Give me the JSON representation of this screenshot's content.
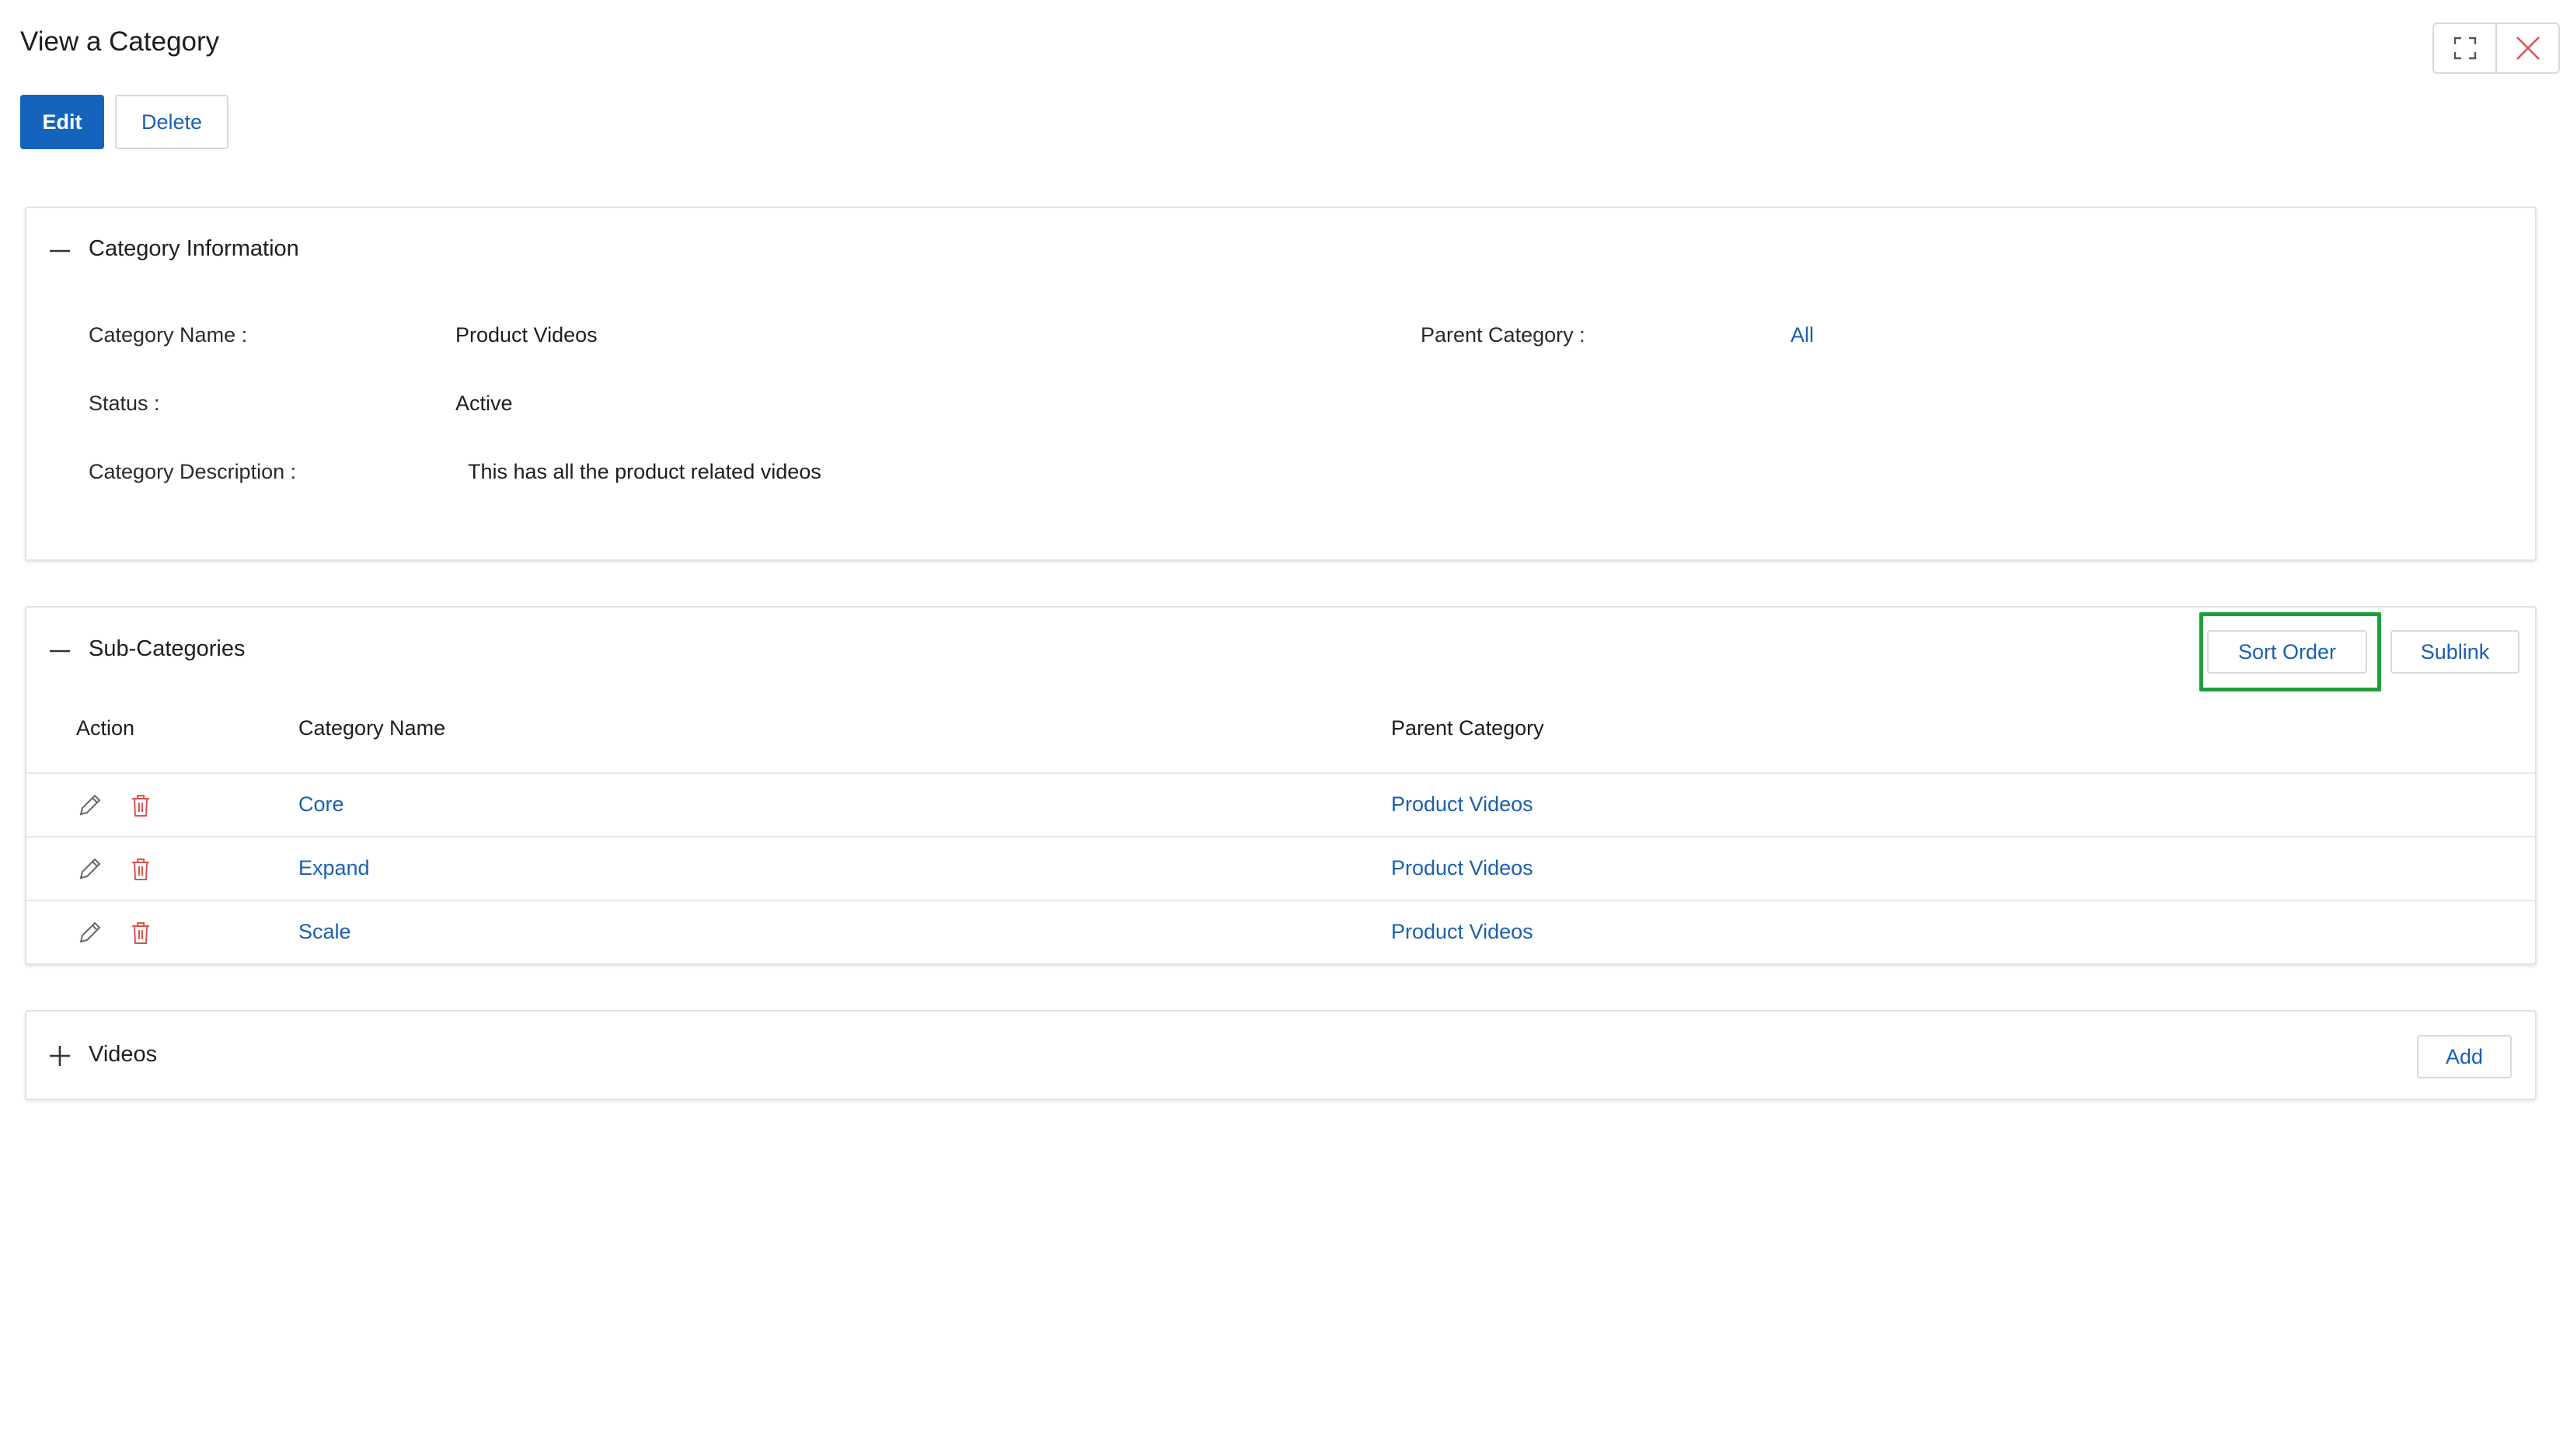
{
  "page": {
    "title": "View a Category",
    "edit_label": "Edit",
    "delete_label": "Delete",
    "window_icons": [
      "expand-icon",
      "close-icon"
    ]
  },
  "category_info": {
    "title": "Category Information",
    "name_label": "Category Name :",
    "name_value": "Product Videos",
    "parent_label": "Parent Category :",
    "parent_value": "All",
    "status_label": "Status :",
    "status_value": "Active",
    "description_label": "Category Description :",
    "description_value": "This has all the product related videos"
  },
  "subcategories": {
    "title": "Sub-Categories",
    "sort_order_label": "Sort Order",
    "sublink_label": "Sublink",
    "columns": [
      "Action",
      "Category Name",
      "Parent Category"
    ],
    "rows": [
      {
        "name": "Core",
        "parent": "Product Videos"
      },
      {
        "name": "Expand",
        "parent": "Product Videos"
      },
      {
        "name": "Scale",
        "parent": "Product Videos"
      }
    ]
  },
  "videos": {
    "title": "Videos",
    "add_label": "Add"
  },
  "colors": {
    "primary": "#1464be",
    "link": "#1a5fb4",
    "delete_icon": "#d9534f",
    "highlight": "#1e9e3c"
  }
}
